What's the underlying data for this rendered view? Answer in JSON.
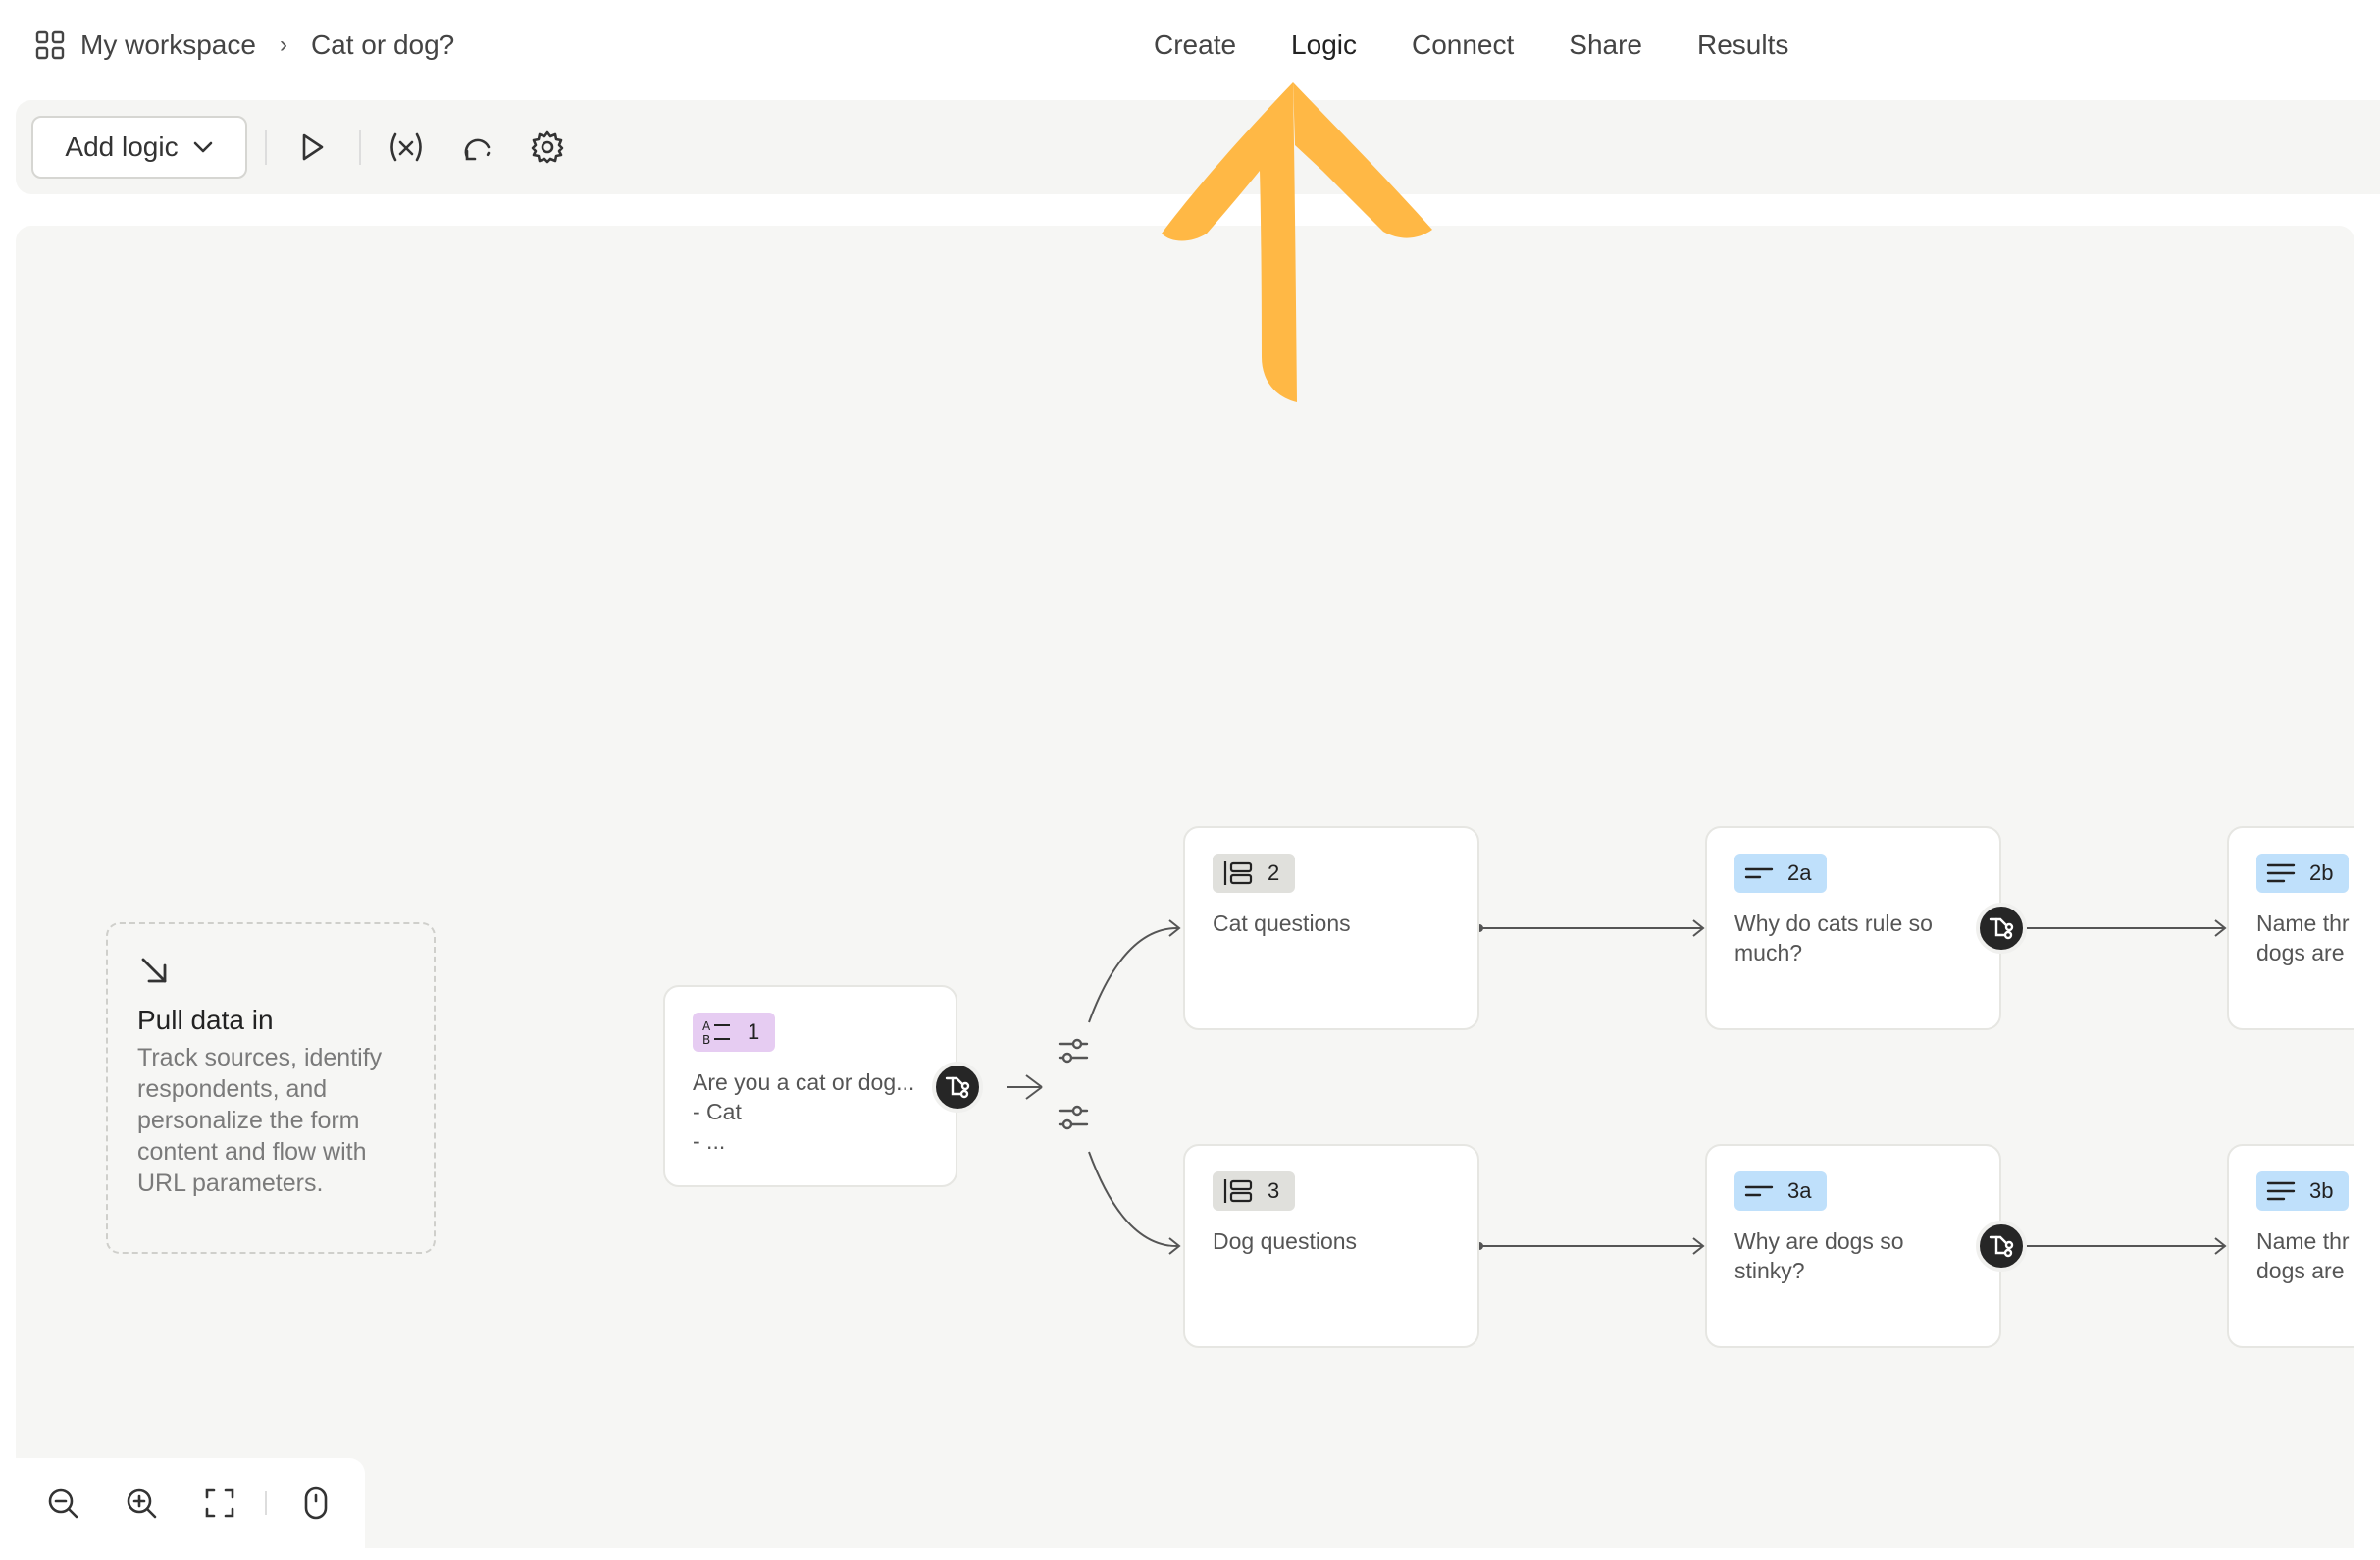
{
  "breadcrumb": {
    "workspace": "My workspace",
    "separator": "›",
    "form": "Cat or dog?"
  },
  "tabs": [
    {
      "label": "Create",
      "active": false
    },
    {
      "label": "Logic",
      "active": true
    },
    {
      "label": "Connect",
      "active": false
    },
    {
      "label": "Share",
      "active": false
    },
    {
      "label": "Results",
      "active": false
    }
  ],
  "toolbar": {
    "add_logic_label": "Add logic",
    "icons": [
      "play-icon",
      "variables-icon",
      "rotate-icon",
      "settings-icon"
    ]
  },
  "pull_data": {
    "title": "Pull data in",
    "description": "Track sources, identify respondents, and personalize the form content and flow with URL parameters."
  },
  "nodes": {
    "q1": {
      "badge": "1",
      "title": "Are you a cat or dog...",
      "line1": "- Cat",
      "line2": "- ..."
    },
    "q2": {
      "badge": "2",
      "title": "Cat questions"
    },
    "q3": {
      "badge": "3",
      "title": "Dog questions"
    },
    "q2a": {
      "badge": "2a",
      "title": "Why do cats rule so much?"
    },
    "q3a": {
      "badge": "3a",
      "title": "Why are dogs so stinky?"
    },
    "q2b": {
      "badge": "2b",
      "title": "Name thr dogs are"
    },
    "q3b": {
      "badge": "3b",
      "title": "Name thr dogs are"
    }
  },
  "colors": {
    "accent_annotation": "#FFB845",
    "badge_purple": "#E6CCF2",
    "badge_grey": "#E0E0DC",
    "badge_blue": "#BFE0FB",
    "branch_button": "#262626",
    "canvas_bg": "#F6F6F4"
  },
  "zoom_controls": [
    "zoom-out-icon",
    "zoom-in-icon",
    "fit-screen-icon",
    "mouse-icon"
  ]
}
